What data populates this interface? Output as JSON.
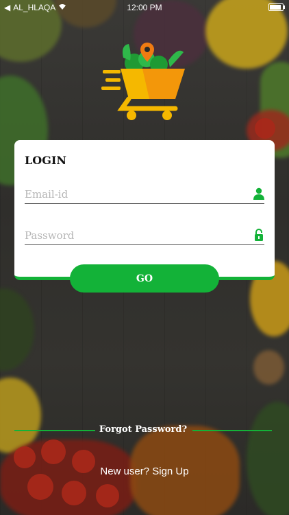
{
  "status_bar": {
    "carrier": "AL_HLAQA",
    "time": "12:00 PM"
  },
  "login_card": {
    "title": "LOGIN",
    "email_placeholder": "Email-id",
    "password_placeholder": "Password",
    "go_label": "GO"
  },
  "links": {
    "forgot_password": "Forgot Password?",
    "signup": "New user? Sign Up"
  },
  "colors": {
    "accent": "#13b238",
    "logo_yellow": "#f5b800",
    "logo_orange": "#f07b12"
  },
  "icons": {
    "logo": "shopping-cart-vegetables-logo",
    "email": "user-icon",
    "password": "unlock-icon"
  }
}
